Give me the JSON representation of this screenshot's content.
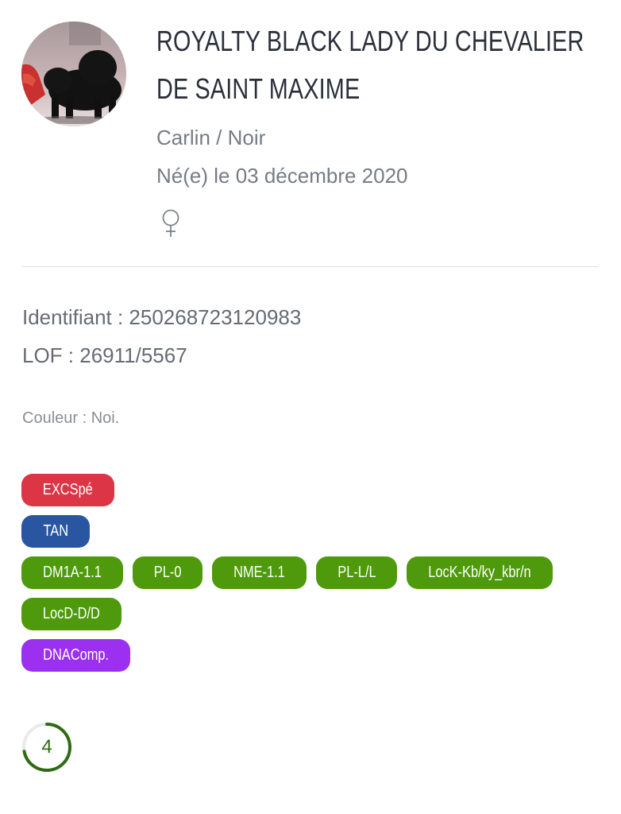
{
  "dog": {
    "name": "ROYALTY BLACK LADY DU CHEVALIER DE SAINT MAXIME",
    "breed_color": "Carlin / Noir",
    "birth": "Né(e) le 03 décembre 2020",
    "sex_icon": "female-icon"
  },
  "details": {
    "identifiant": "Identifiant : 250268723120983",
    "lof": "LOF : 26911/5567",
    "couleur": "Couleur : Noi."
  },
  "badges": [
    [
      {
        "label": "EXCSpé",
        "color": "#dc3545"
      }
    ],
    [
      {
        "label": "TAN",
        "color": "#2a55a0"
      }
    ],
    [
      {
        "label": "DM1A-1.1",
        "color": "#4e9a0c"
      },
      {
        "label": "PL-0",
        "color": "#4e9a0c"
      },
      {
        "label": "NME-1.1",
        "color": "#4e9a0c"
      },
      {
        "label": "PL-L/L",
        "color": "#4e9a0c"
      },
      {
        "label": "LocK-Kb/ky_kbr/n",
        "color": "#4e9a0c"
      }
    ],
    [
      {
        "label": "LocD-D/D",
        "color": "#4e9a0c"
      }
    ],
    [
      {
        "label": "DNAComp.",
        "color": "#9b30f0"
      }
    ]
  ],
  "score": {
    "value": "4",
    "fraction": 0.72,
    "color": "#2e6b14"
  }
}
